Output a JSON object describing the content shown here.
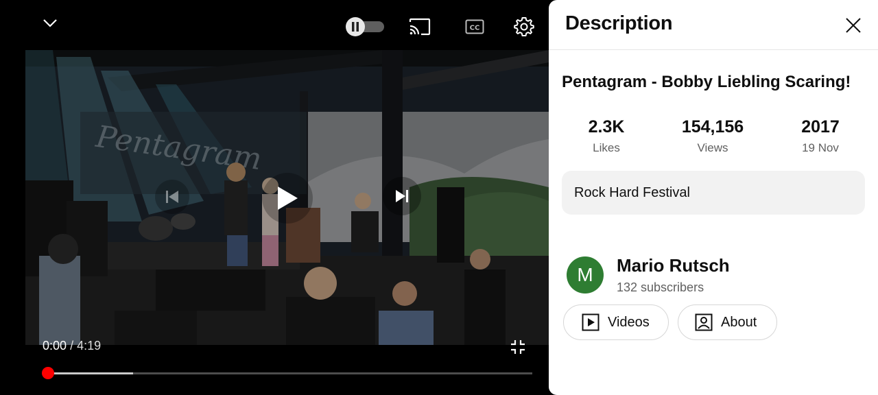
{
  "player": {
    "time": {
      "current": "0:00",
      "separator": "/",
      "duration": "4:19"
    },
    "progress": {
      "played_fraction": 0.0,
      "buffered_fraction": 0.175
    },
    "autoplay_state": "paused",
    "icons": {
      "minimize": "chevron-down-icon",
      "autoplay": "pause-toggle-icon",
      "cast": "cast-icon",
      "captions": "cc-icon",
      "settings": "gear-icon",
      "previous": "skip-previous-icon",
      "play": "play-icon",
      "next": "skip-next-icon",
      "exit_fullscreen": "exit-fullscreen-icon"
    },
    "colors": {
      "progress_played": "#ff0000"
    }
  },
  "description_panel": {
    "header_title": "Description",
    "video_title": "Pentagram - Bobby Liebling Scaring!",
    "stats": {
      "likes_value": "2.3K",
      "likes_label": "Likes",
      "views_value": "154,156",
      "views_label": "Views",
      "year_value": "2017",
      "date_label": "19 Nov"
    },
    "description_text": "Rock Hard Festival",
    "channel": {
      "avatar_letter": "M",
      "name": "Mario Rutsch",
      "subscribers": "132 subscribers",
      "avatar_color": "#2e7d32"
    },
    "buttons": {
      "videos_label": "Videos",
      "about_label": "About"
    }
  }
}
